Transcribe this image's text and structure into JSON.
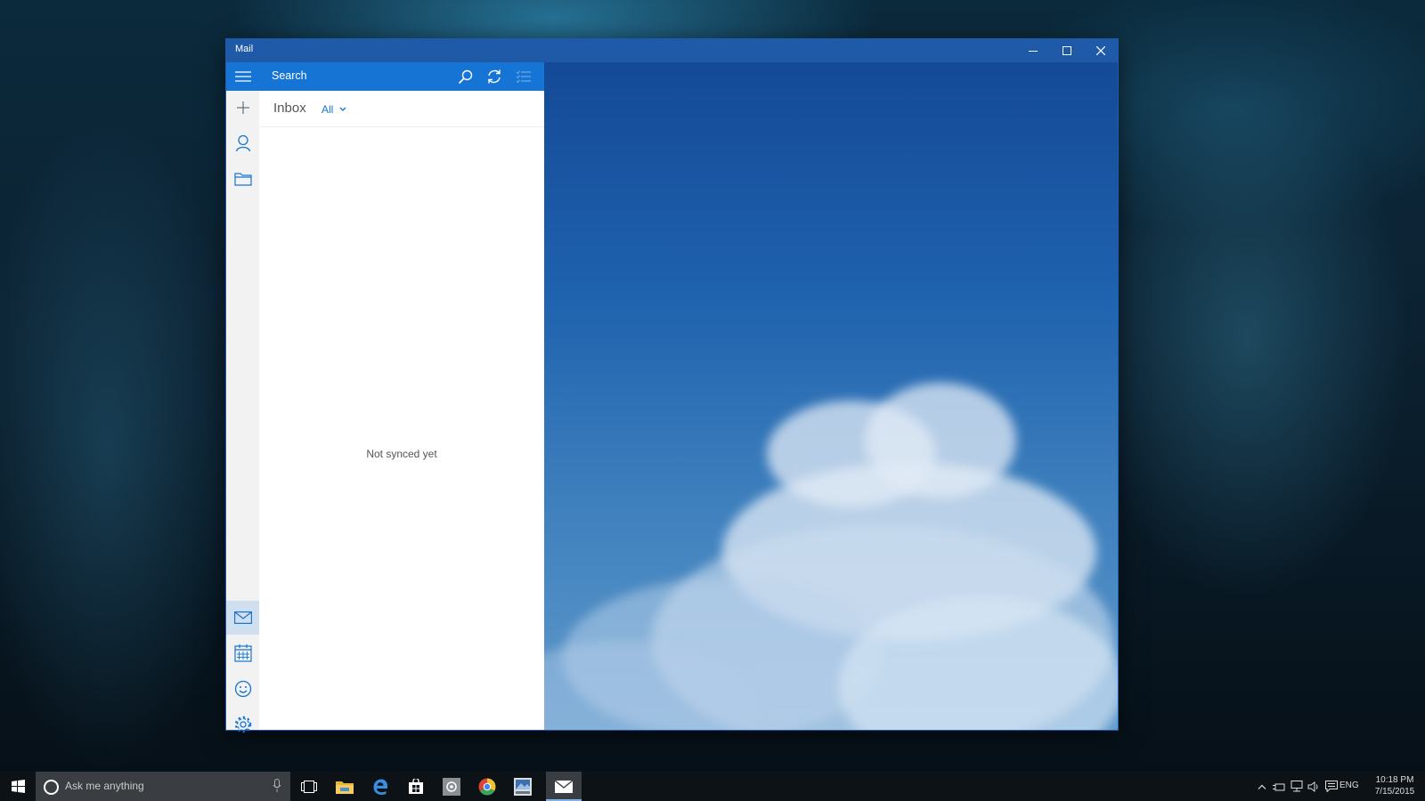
{
  "window": {
    "title": "Mail",
    "accent_color": "#1e5aa8",
    "controls": [
      "minimize-icon",
      "maximize-icon",
      "close-icon"
    ]
  },
  "rail": {
    "top_items": [
      "hamburger-menu-icon",
      "new-mail-icon",
      "accounts-icon",
      "folders-icon"
    ],
    "bottom_items": [
      "mail-icon",
      "calendar-icon",
      "feedback-smiley-icon",
      "settings-gear-icon"
    ],
    "active_item": "mail-icon"
  },
  "search": {
    "placeholder": "Search",
    "icons": [
      "search-icon",
      "sync-icon",
      "select-mode-icon"
    ]
  },
  "folder": {
    "name": "Inbox",
    "filter": "All"
  },
  "message_list": {
    "status": "Not synced yet"
  },
  "taskbar": {
    "search_placeholder": "Ask me anything",
    "pinned": [
      "start-icon",
      "task-view-icon",
      "file-explorer-icon",
      "edge-icon",
      "store-icon",
      "media-app-icon",
      "chrome-icon",
      "photo-app-icon",
      "mail-app-icon"
    ],
    "active_app": "mail-app-icon",
    "tray": {
      "language": "ENG",
      "time": "10:18 PM",
      "date": "7/15/2015"
    }
  }
}
